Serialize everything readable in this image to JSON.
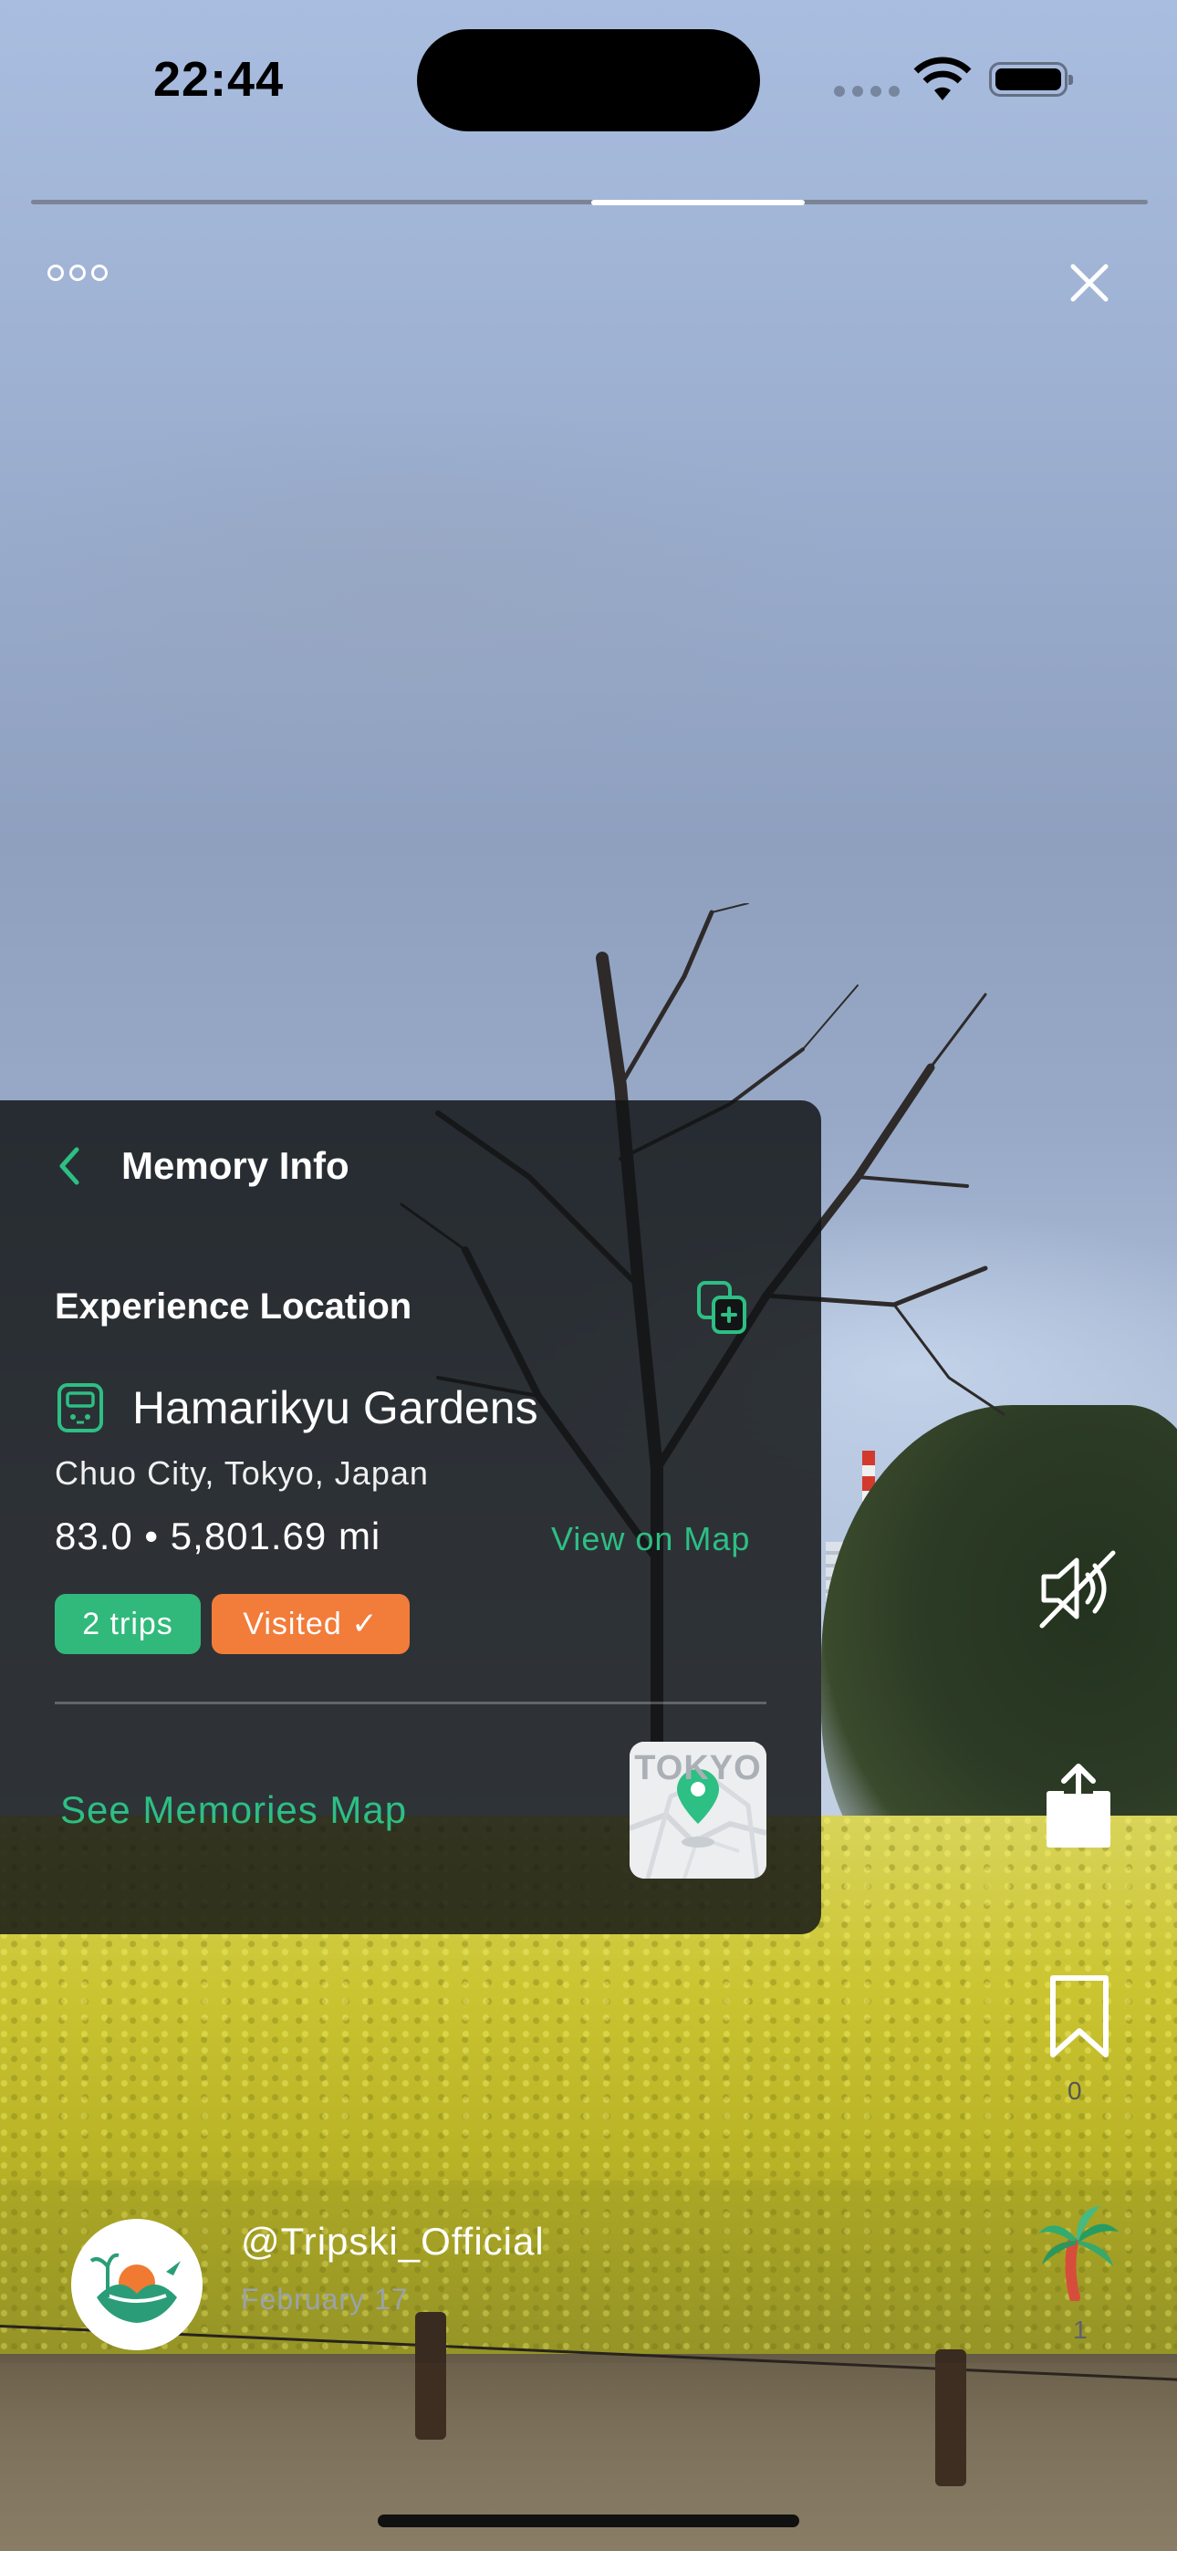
{
  "status_bar": {
    "time": "22:44"
  },
  "story": {
    "progress_segment": "3 of 6"
  },
  "panel": {
    "title": "Memory Info",
    "section_title": "Experience Location",
    "place_name": "Hamarikyu Gardens",
    "address": "Chuo City, Tokyo, Japan",
    "stats": "83.0 • 5,801.69 mi",
    "view_on_map": "View on Map",
    "badges": {
      "trips": "2 trips",
      "visited": "Visited ✓"
    },
    "see_memories_map": "See Memories Map",
    "map_thumb_text": "TOKYO"
  },
  "actions": {
    "mute_icon": "speaker-muted-icon",
    "share_icon": "share-icon",
    "bookmark_icon": "bookmark-icon",
    "bookmark_count": "0",
    "palm_icon": "palm-tree-icon",
    "palm_count": "1"
  },
  "author": {
    "handle": "@Tripski_Official",
    "date": "February 17"
  },
  "colors": {
    "accent": "#2dbf84",
    "visited": "#f27c3a",
    "trips": "#30b97b"
  }
}
